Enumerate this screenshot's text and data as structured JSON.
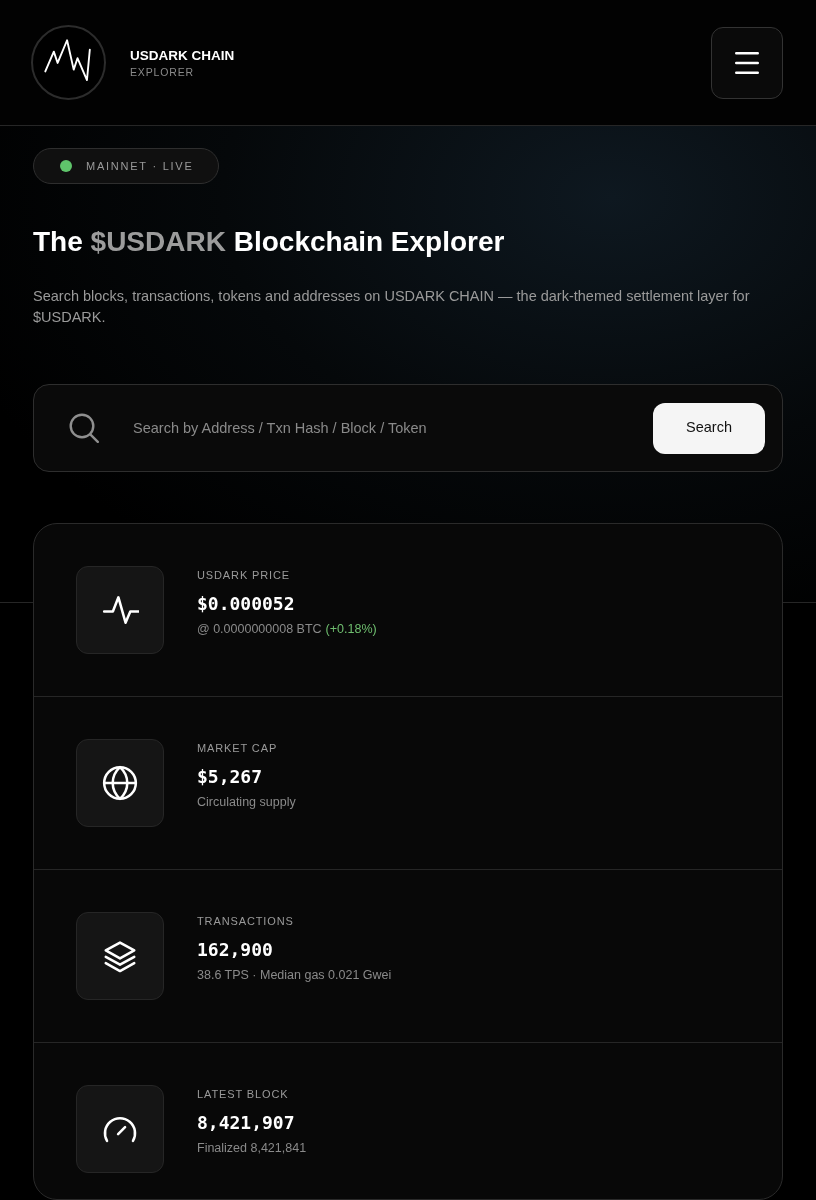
{
  "header": {
    "title": "USDARK CHAIN",
    "subtitle": "EXPLORER"
  },
  "status_badge": {
    "label": "MAINNET · LIVE",
    "live": true
  },
  "heading": [
    {
      "text": "The",
      "accent": false
    },
    {
      "text": "$USDARK",
      "accent": true
    },
    {
      "text": "Blockchain Explorer",
      "accent": false
    }
  ],
  "description": "Search blocks, transactions, tokens and addresses on USDARK CHAIN — the dark-themed settlement layer for $USDARK.",
  "search": {
    "placeholder": "Search by Address / Txn Hash / Block / Token",
    "button": "Search"
  },
  "stats": [
    {
      "kind": "price",
      "label": "USDARK PRICE",
      "value": "$0.000052",
      "detail": "@ 0.0000000008 BTC",
      "change": {
        "text": "(+0.18%)",
        "positive": true
      }
    },
    {
      "kind": "market_cap",
      "label": "MARKET CAP",
      "value": "$5,267",
      "detail": "Circulating supply"
    },
    {
      "kind": "transactions",
      "label": "TRANSACTIONS",
      "value": "162,900",
      "detail": "38.6 TPS · Median gas 0.021 Gwei"
    },
    {
      "kind": "latest_block",
      "label": "LATEST BLOCK",
      "value": "8,421,907",
      "detail": "Finalized 8,421,841"
    }
  ]
}
